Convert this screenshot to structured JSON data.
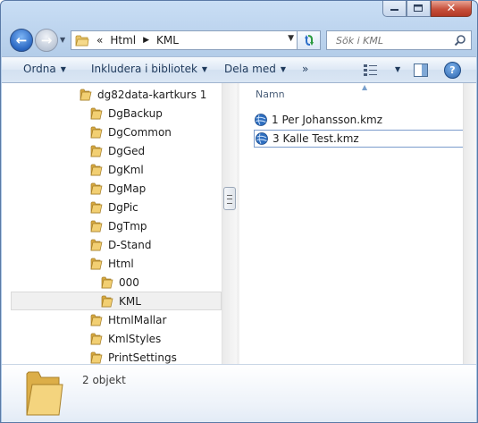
{
  "window": {
    "caption": {
      "minimize": "–",
      "maximize": "□",
      "close": "✕"
    }
  },
  "address": {
    "overflow": "«",
    "crumbs": [
      "Html",
      "KML"
    ],
    "search_placeholder": "Sök i KML"
  },
  "toolbar": {
    "organize": "Ordna",
    "include_in_library": "Inkludera i bibliotek",
    "share_with": "Dela med",
    "more": "»",
    "help": "?"
  },
  "tree": {
    "items": [
      {
        "label": "dg82data-kartkurs 1",
        "level": 0
      },
      {
        "label": "DgBackup",
        "level": 1
      },
      {
        "label": "DgCommon",
        "level": 1
      },
      {
        "label": "DgGed",
        "level": 1
      },
      {
        "label": "DgKml",
        "level": 1
      },
      {
        "label": "DgMap",
        "level": 1
      },
      {
        "label": "DgPic",
        "level": 1
      },
      {
        "label": "DgTmp",
        "level": 1
      },
      {
        "label": "D-Stand",
        "level": 1
      },
      {
        "label": "Html",
        "level": 1
      },
      {
        "label": "000",
        "level": 2
      },
      {
        "label": "KML",
        "level": 2,
        "selected": true
      },
      {
        "label": "HtmlMallar",
        "level": 1
      },
      {
        "label": "KmlStyles",
        "level": 1
      },
      {
        "label": "PrintSettings",
        "level": 1
      }
    ]
  },
  "content": {
    "column_name": "Namn",
    "files": [
      {
        "name": "1 Per Johansson.kmz",
        "icon": "kmz-globe-icon"
      },
      {
        "name": "3 Kalle Test.kmz",
        "icon": "kmz-globe-icon",
        "focused": true
      }
    ]
  },
  "details": {
    "count_text": "2 objekt"
  },
  "colors": {
    "chrome": "#b9d1ea",
    "folder": "#e8c46a",
    "selection": "#f0f0f0",
    "text": "#1e395b"
  }
}
